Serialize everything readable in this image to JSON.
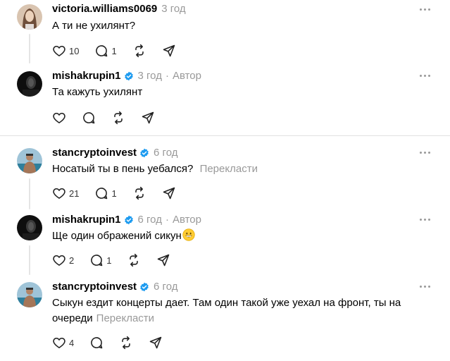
{
  "posts": [
    {
      "username": "victoria.williams0069",
      "time": "3 год",
      "author_badge": "",
      "text": "А ти не ухилянт?",
      "translate": "",
      "likes": "10",
      "replies": "1",
      "reposts": "",
      "verified": false,
      "avatar": "photo-woman"
    },
    {
      "username": "mishakrupin1",
      "time": "3 год",
      "dot": "·",
      "author_badge": "Автор",
      "text": "Та кажуть ухилянт",
      "translate": "",
      "likes": "",
      "replies": "",
      "verified": true,
      "avatar": "photo-dark"
    },
    {
      "username": "stancryptoinvest",
      "time": "6 год",
      "text": "Носатый ты в пень уебался?",
      "translate": "Перекласти",
      "likes": "21",
      "replies": "1",
      "verified": true,
      "avatar": "photo-beach"
    },
    {
      "username": "mishakrupin1",
      "time": "6 год",
      "dot": "·",
      "author_badge": "Автор",
      "text": "Ще один ображений сикун",
      "emoji": "grinning-face-emoji",
      "likes": "2",
      "replies": "1",
      "verified": true,
      "avatar": "photo-dark"
    },
    {
      "username": "stancryptoinvest",
      "time": "6 год",
      "text_line1": "Сыкун ездит концерты дает. Там один такой уже уехал на фронт, ты на",
      "text_line2": "очереди",
      "translate": "Перекласти",
      "likes": "4",
      "replies": "",
      "verified": true,
      "avatar": "photo-beach"
    }
  ],
  "colors": {
    "verified": "#1d9bf0",
    "muted": "#999999",
    "divider": "#e0e0e0"
  }
}
